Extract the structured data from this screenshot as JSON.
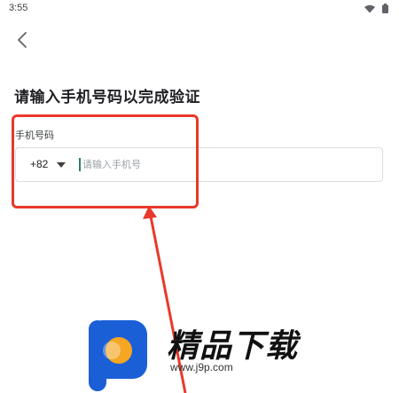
{
  "status_bar": {
    "time": "3:55",
    "icons": [
      "wifi-icon",
      "battery-icon"
    ]
  },
  "header": {
    "back_icon": "chevron-left-icon"
  },
  "page": {
    "title": "请输入手机号码以完成验证"
  },
  "phone_field": {
    "label": "手机号码",
    "country_code": "+82",
    "placeholder": "请输入手机号",
    "value": ""
  },
  "colors": {
    "highlight": "#e8392b",
    "cursor": "#2e7d6d",
    "border": "#dcdcdc"
  },
  "watermark": {
    "title": "精品下载",
    "url": "www.j9p.com"
  }
}
